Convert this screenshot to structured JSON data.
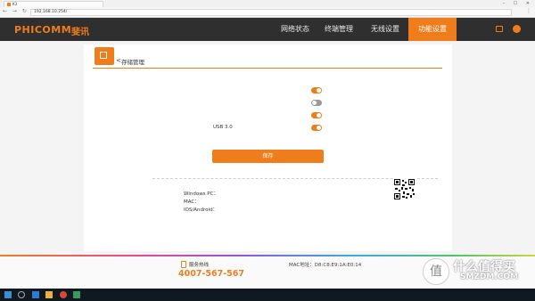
{
  "browser": {
    "tab_title": "K3",
    "window_controls": "– ☐ ✕",
    "nav_buttons": "← → ↻",
    "url": "192.168.10.254/",
    "menu": "⋮"
  },
  "header": {
    "logo": "PHICOMM",
    "logo_cn": "斐讯",
    "tabs": [
      "网络状态",
      "终端管理",
      "无线设置",
      "功能设置"
    ],
    "active_tab": 3,
    "accent": "#f07d1b"
  },
  "page": {
    "back": "<",
    "title": "存储管理"
  },
  "storage": {
    "status_text": "",
    "rows": [
      {
        "label": "",
        "state": "on"
      },
      {
        "label": "",
        "state": "off"
      },
      {
        "label": "",
        "state": "on"
      },
      {
        "label": "USB 3.0",
        "state": "on"
      }
    ],
    "hint": "",
    "save": "保存"
  },
  "access": {
    "title": "",
    "rows": [
      {
        "label": "Windows PC：",
        "value": ""
      },
      {
        "label": "MAC：",
        "value": ""
      },
      {
        "label": "IOS/Android：",
        "value": ""
      }
    ],
    "qr_caption": ""
  },
  "footer": {
    "hotline_label": "服务热线",
    "hotline": "4007-567-567",
    "links": "",
    "mac_label": "MAC地址：",
    "mac": "D8:C8:E9:1A:E0:14",
    "copyright": ""
  },
  "watermark": {
    "icon": "值",
    "text": "什么值得买",
    "sub": "SMZDM.COM"
  },
  "taskbar": {
    "time": "",
    "date": "",
    "tray": ""
  }
}
